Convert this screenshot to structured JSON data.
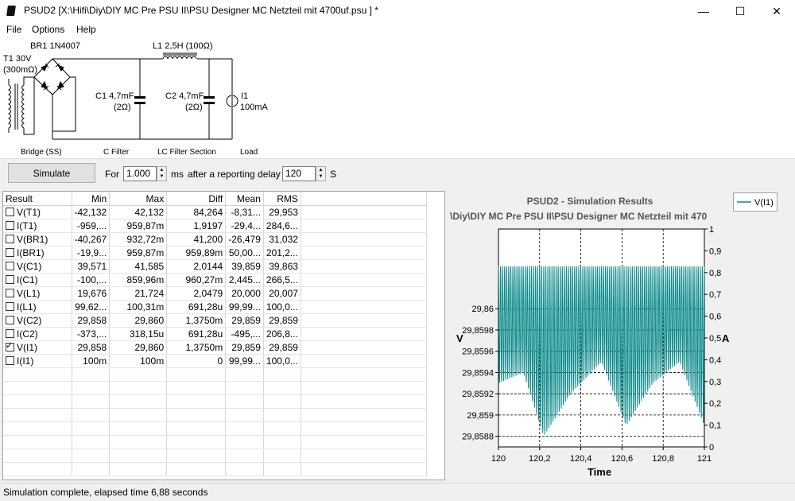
{
  "window": {
    "app_name": "PSUD2",
    "title": "PSUD2  [X:\\Hifi\\Diy\\DIY MC Pre PSU II\\PSU Designer MC Netzteil mit 4700uf.psu ] *",
    "minimize_glyph": "—",
    "maximize_glyph": "☐",
    "close_glyph": "✕"
  },
  "menu": {
    "file": "File",
    "options": "Options",
    "help": "Help"
  },
  "schematic": {
    "t1_label": "T1 30V",
    "t1_res": "(300mΩ)",
    "br1_label": "BR1 1N4007",
    "l1_label": "L1 2,5H (100Ω)",
    "c1_label": "C1 4,7mF",
    "c1_res": "(2Ω)",
    "c2_label": "C2 4,7mF",
    "c2_res": "(2Ω)",
    "i1_label": "I1",
    "i1_value": "100mA",
    "section_bridge": "Bridge (SS)",
    "section_cfilter": "C Filter",
    "section_lcfilter": "LC Filter Section",
    "section_load": "Load"
  },
  "simulate": {
    "button": "Simulate",
    "for_label": "For",
    "duration": "1.000",
    "ms_label": "ms",
    "delay_label": "after a reporting delay of",
    "delay": "120",
    "s_label": "S"
  },
  "results": {
    "headers": [
      "Result",
      "Min",
      "Max",
      "Diff",
      "Mean",
      "RMS"
    ],
    "rows": [
      {
        "name": "V(T1)",
        "checked": false,
        "min": "-42,132",
        "max": "42,132",
        "diff": "84,264",
        "mean": "-8,31...",
        "rms": "29,953"
      },
      {
        "name": "I(T1)",
        "checked": false,
        "min": "-959,...",
        "max": "959,87m",
        "diff": "1,9197",
        "mean": "-29,4...",
        "rms": "284,6..."
      },
      {
        "name": "V(BR1)",
        "checked": false,
        "min": "-40,267",
        "max": "932,72m",
        "diff": "41,200",
        "mean": "-26,479",
        "rms": "31,032"
      },
      {
        "name": "I(BR1)",
        "checked": false,
        "min": "-19,9...",
        "max": "959,87m",
        "diff": "959,89m",
        "mean": "50,00...",
        "rms": "201,2..."
      },
      {
        "name": "V(C1)",
        "checked": false,
        "min": "39,571",
        "max": "41,585",
        "diff": "2,0144",
        "mean": "39,859",
        "rms": "39,863"
      },
      {
        "name": "I(C1)",
        "checked": false,
        "min": "-100,...",
        "max": "859,96m",
        "diff": "960,27m",
        "mean": "2,445...",
        "rms": "266,5..."
      },
      {
        "name": "V(L1)",
        "checked": false,
        "min": "19,676",
        "max": "21,724",
        "diff": "2,0479",
        "mean": "20,000",
        "rms": "20,007"
      },
      {
        "name": "I(L1)",
        "checked": false,
        "min": "99,62...",
        "max": "100,31m",
        "diff": "691,28u",
        "mean": "99,99...",
        "rms": "100,0..."
      },
      {
        "name": "V(C2)",
        "checked": false,
        "min": "29,858",
        "max": "29,860",
        "diff": "1,3750m",
        "mean": "29,859",
        "rms": "29,859"
      },
      {
        "name": "I(C2)",
        "checked": false,
        "min": "-373,...",
        "max": "318,15u",
        "diff": "691,28u",
        "mean": "-495,...",
        "rms": "206,8..."
      },
      {
        "name": "V(I1)",
        "checked": true,
        "min": "29,858",
        "max": "29,860",
        "diff": "1,3750m",
        "mean": "29,859",
        "rms": "29,859"
      },
      {
        "name": "I(I1)",
        "checked": false,
        "min": "100m",
        "max": "100m",
        "diff": "0",
        "mean": "99,99...",
        "rms": "100,0..."
      }
    ]
  },
  "chart_data": {
    "type": "line",
    "title": "PSUD2 - Simulation Results",
    "subtitle": "\\Diy\\DIY MC Pre PSU II\\PSU Designer MC Netzteil mit 470",
    "xlabel": "Time",
    "ylabel": "V",
    "y2label": "A",
    "xlim": [
      120,
      121
    ],
    "ylim": [
      29.8587,
      29.86075
    ],
    "y2lim": [
      0,
      1
    ],
    "x_ticks": [
      "120",
      "120,2",
      "120,4",
      "120,6",
      "120,8",
      "121"
    ],
    "y_ticks": [
      "29,86",
      "29,8598",
      "29,8596",
      "29,8594",
      "29,8592",
      "29,859",
      "29,8588"
    ],
    "y_tick_values": [
      29.86,
      29.8598,
      29.8596,
      29.8594,
      29.8592,
      29.859,
      29.8588
    ],
    "y2_ticks": [
      "1",
      "0,9",
      "0,8",
      "0,7",
      "0,6",
      "0,5",
      "0,4",
      "0,3",
      "0,2",
      "0,1",
      "0"
    ],
    "legend_placement": "top-right",
    "grid": true,
    "series": [
      {
        "name": "V(I1)",
        "color": "#0e8a8a",
        "ripple_frequency_per_unit": 100,
        "peak_max": 29.8604,
        "trough_min_envelope": [
          [
            120.0,
            29.8593
          ],
          [
            120.12,
            29.8594
          ],
          [
            120.22,
            29.8588
          ],
          [
            120.35,
            29.8592
          ],
          [
            120.5,
            29.8595
          ],
          [
            120.62,
            29.8589
          ],
          [
            120.75,
            29.8593
          ],
          [
            120.88,
            29.8595
          ],
          [
            121.0,
            29.8589
          ]
        ]
      }
    ]
  },
  "status": {
    "text": "Simulation complete, elapsed time 6,88 seconds"
  }
}
